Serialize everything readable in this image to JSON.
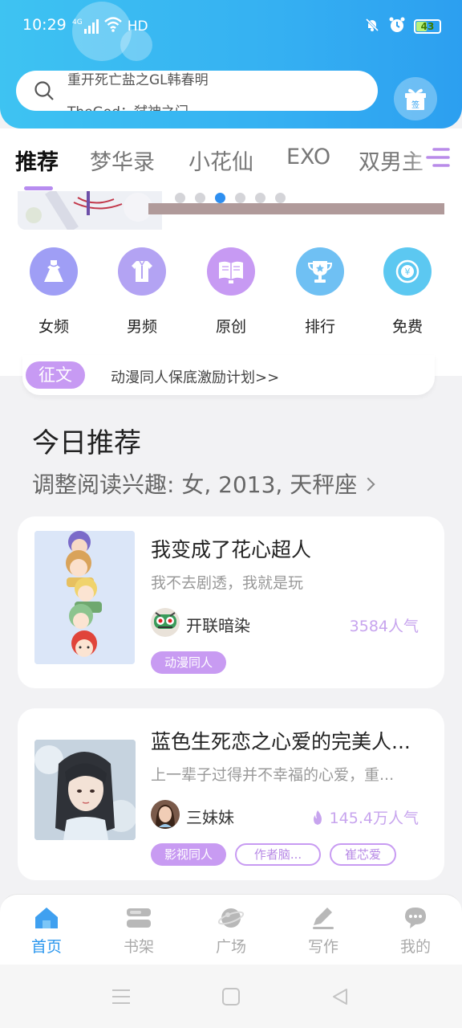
{
  "status_bar": {
    "time": "10:29",
    "signal": "4G",
    "network": "HD",
    "battery": "43"
  },
  "search": {
    "lines": [
      "重开死亡盐之GL韩春明",
      "TheGod：弑神之门"
    ]
  },
  "gift": {
    "label": "签"
  },
  "tabs": [
    {
      "label": "推荐",
      "active": true
    },
    {
      "label": "梦华录"
    },
    {
      "label": "小花仙"
    },
    {
      "label": "EXO"
    },
    {
      "label": "双男主"
    }
  ],
  "carousel": {
    "dots": 6,
    "active_index": 2
  },
  "categories": [
    {
      "label": "女频",
      "icon": "dress-icon",
      "color": "#9f9ef5"
    },
    {
      "label": "男频",
      "icon": "shirt-icon",
      "color": "#b3a3f3"
    },
    {
      "label": "原创",
      "icon": "book-icon",
      "color": "#c79af3"
    },
    {
      "label": "排行",
      "icon": "trophy-icon",
      "color": "#6fc0f3"
    },
    {
      "label": "免费",
      "icon": "coin-icon",
      "color": "#5cc8f1"
    }
  ],
  "notice": {
    "tag": "征文",
    "text": "动漫同人保底激励计划>>"
  },
  "section": {
    "title": "今日推荐",
    "subtitle": "调整阅读兴趣: 女, 2013, 天秤座"
  },
  "books": [
    {
      "title": "我变成了花心超人",
      "desc": "我不去剧透，我就是玩",
      "author": "开联暗染",
      "popularity": "3584人气",
      "hot": false,
      "tags": [
        "动漫同人"
      ]
    },
    {
      "title": "蓝色生死恋之心爱的完美人...",
      "desc": "上一辈子过得并不幸福的心爱，重...",
      "author": "三妹妹",
      "popularity": "145.4万人气",
      "hot": true,
      "tags": [
        "影视同人",
        "作者脑...",
        "崔芯爱"
      ]
    }
  ],
  "bottom_nav": [
    {
      "label": "首页",
      "icon": "home-icon",
      "active": true
    },
    {
      "label": "书架",
      "icon": "bookshelf-icon"
    },
    {
      "label": "广场",
      "icon": "planet-icon"
    },
    {
      "label": "写作",
      "icon": "pen-icon"
    },
    {
      "label": "我的",
      "icon": "chat-icon"
    }
  ],
  "colors": {
    "accent": "#2b97ee",
    "purple": "#c89bf2",
    "header": "#35b0f2"
  }
}
